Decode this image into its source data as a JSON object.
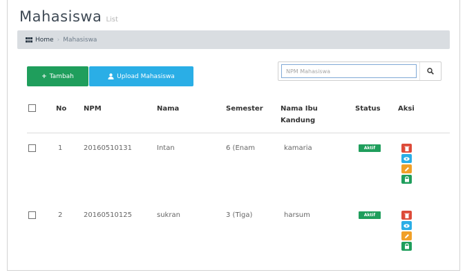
{
  "header": {
    "title": "Mahasiswa",
    "subtitle": "List"
  },
  "breadcrumb": {
    "home": "Home",
    "current": "Mahasiswa"
  },
  "toolbar": {
    "add_label": "Tambah",
    "upload_label": "Upload Mahasiswa",
    "search_placeholder": "NPM Mahasiswa"
  },
  "table": {
    "headers": {
      "no": "No",
      "npm": "NPM",
      "nama": "Nama",
      "semester": "Semester",
      "ibu_line1": "Nama Ibu",
      "ibu_line2": "Kandung",
      "status": "Status",
      "aksi": "Aksi"
    },
    "rows": [
      {
        "no": "1",
        "npm": "20160510131",
        "nama": "Intan",
        "semester": "6 (Enam",
        "ibu": "kamaria",
        "status": "Aktif"
      },
      {
        "no": "2",
        "npm": "20160510125",
        "nama": "sukran",
        "semester": "3 (Tiga)",
        "ibu": "harsum",
        "status": "Aktif"
      }
    ]
  },
  "colors": {
    "green": "#1f9e5c",
    "blue": "#2aaee6",
    "red": "#dd4b39",
    "orange": "#f0a028",
    "breadcrumb_bg": "#d9dde1"
  },
  "icons": {
    "breadcrumb": "dashboard-grid-icon",
    "add": "plus-icon",
    "upload": "user-upload-icon",
    "search": "search-icon",
    "actions": [
      "trash-icon",
      "eye-icon",
      "edit-icon",
      "lock-icon"
    ]
  }
}
